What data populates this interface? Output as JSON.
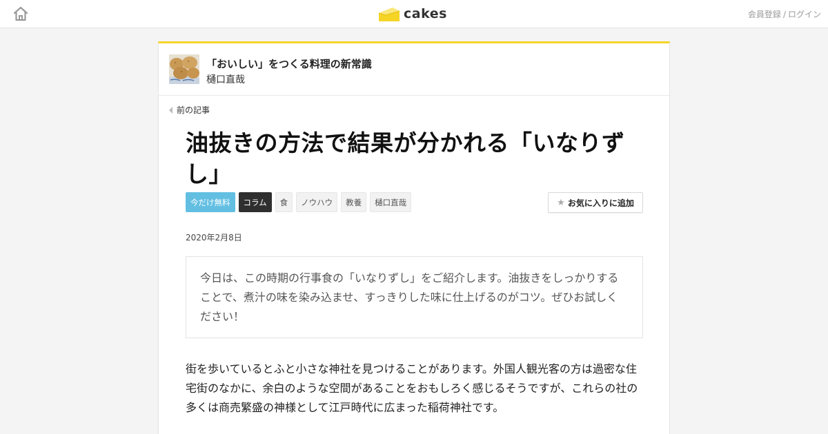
{
  "header": {
    "logo_text": "cakes",
    "register_label": "会員登録",
    "separator": "/",
    "login_label": "ログイン",
    "accent_color": "#f5d426"
  },
  "series": {
    "title": "「おいしい」をつくる料理の新常識",
    "author": "樋口直哉"
  },
  "nav": {
    "prev_label": "前の記事"
  },
  "article": {
    "title": "油抜きの方法で結果が分かれる「いなりずし」",
    "tags": [
      "今だけ無料",
      "コラム",
      "食",
      "ノウハウ",
      "教養",
      "樋口直哉"
    ],
    "favorite_label": "お気に入りに追加",
    "date": "2020年2月8日",
    "lead": "今日は、この時期の行事食の「いなりずし」をご紹介します。油抜きをしっかりすることで、煮汁の味を染み込ませ、すっきりした味に仕上げるのがコツ。ぜひお試しください！",
    "body": "街を歩いているとふと小さな神社を見つけることがあります。外国人観光客の方は過密な住宅街のなかに、余白のような空間があることをおもしろく感じるそうですが、これらの社の多くは商売繁盛の神様として江戸時代に広まった稲荷神社です。"
  },
  "icons": {
    "home": "home-icon",
    "logo": "cheese-wedge-icon",
    "prev": "triangle-left-icon",
    "favorite": "star-icon"
  }
}
